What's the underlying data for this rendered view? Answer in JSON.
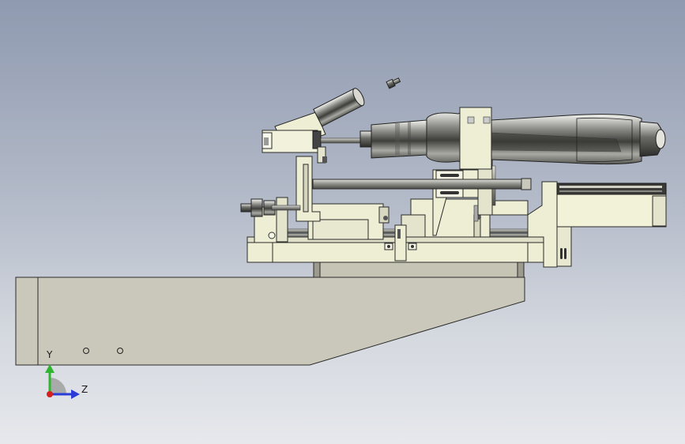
{
  "viewport": {
    "background_top": "#8f9ab0",
    "background_bottom": "#e6e8ec"
  },
  "triad": {
    "y_label": "Y",
    "z_label": "Z",
    "y_color": "#2fb52f",
    "z_color": "#2a3bd8",
    "x_color": "#d42020"
  }
}
